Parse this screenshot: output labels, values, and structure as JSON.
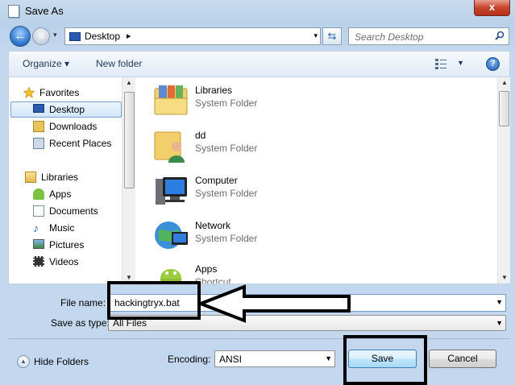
{
  "window": {
    "title": "Save As",
    "close_symbol": "x"
  },
  "address_bar": {
    "back_symbol": "←",
    "forward_symbol": "→",
    "path_label": "Desktop",
    "path_separator": "▸",
    "refresh_symbol": "⇆"
  },
  "search": {
    "placeholder": "Search Desktop"
  },
  "toolbar": {
    "organize_label": "Organize ▾",
    "new_folder_label": "New folder",
    "help_symbol": "?"
  },
  "navigation": {
    "favorites_header": "Favorites",
    "favorites": [
      {
        "label": "Desktop",
        "icon": "desktop-icon",
        "selected": true
      },
      {
        "label": "Downloads",
        "icon": "downloads-icon"
      },
      {
        "label": "Recent Places",
        "icon": "recent-places-icon"
      }
    ],
    "libraries_header": "Libraries",
    "libraries": [
      {
        "label": "Apps",
        "icon": "apps-icon"
      },
      {
        "label": "Documents",
        "icon": "documents-icon"
      },
      {
        "label": "Music",
        "icon": "music-icon"
      },
      {
        "label": "Pictures",
        "icon": "pictures-icon"
      },
      {
        "label": "Videos",
        "icon": "videos-icon"
      }
    ]
  },
  "files": [
    {
      "name": "Libraries",
      "type": "System Folder",
      "icon": "libraries-folder-icon"
    },
    {
      "name": "dd",
      "type": "System Folder",
      "icon": "user-folder-icon"
    },
    {
      "name": "Computer",
      "type": "System Folder",
      "icon": "computer-icon"
    },
    {
      "name": "Network",
      "type": "System Folder",
      "icon": "network-icon"
    },
    {
      "name": "Apps",
      "type": "Shortcut",
      "icon": "apps-shortcut-icon"
    }
  ],
  "form": {
    "file_name_label": "File name:",
    "file_name_value": "hackingtryx.bat",
    "save_as_type_label": "Save as type:",
    "save_as_type_value": "All Files",
    "encoding_label": "Encoding:",
    "encoding_value": "ANSI"
  },
  "footer": {
    "hide_folders_label": "Hide Folders",
    "save_label": "Save",
    "cancel_label": "Cancel"
  },
  "colors": {
    "window_frame": "#b9d1ea",
    "close_button": "#c7452d",
    "selection": "#d2e6fa",
    "save_button": "#bee6fd",
    "annotation": "#000000"
  }
}
